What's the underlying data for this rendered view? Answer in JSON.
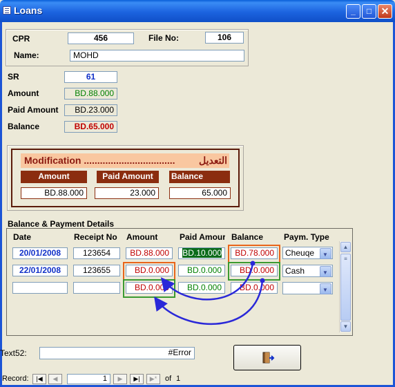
{
  "window": {
    "title": "Loans"
  },
  "header": {
    "cpr_label": "CPR",
    "cpr_value": "456",
    "file_label": "File No:",
    "file_value": "106",
    "name_label": "Name:",
    "name_value": "MOHD"
  },
  "summary": {
    "sr_label": "SR",
    "sr_value": "61",
    "amount_label": "Amount",
    "amount_value": "BD.88.000",
    "paid_label": "Paid Amount",
    "paid_value": "BD.23.000",
    "balance_label": "Balance",
    "balance_value": "BD.65.000"
  },
  "modification": {
    "title": "Modification ..................................",
    "title_ar": "التعديل",
    "headers": [
      "Amount",
      "Paid Amount",
      "Balance"
    ],
    "values": [
      "BD.88.000",
      "23.000",
      "65.000"
    ]
  },
  "details": {
    "section_title": "Balance & Payment Details",
    "columns": [
      "Date",
      "Receipt No",
      "Amount",
      "Paid Amour",
      "Balance",
      "Paym. Type"
    ],
    "rows": [
      {
        "date": "20/01/2008",
        "receipt": "123654",
        "amount": "BD.88.000",
        "paid": "BD.10.000",
        "balance": "BD.78.000",
        "type": "Cheuqe"
      },
      {
        "date": "22/01/2008",
        "receipt": "123655",
        "amount": "BD.0.000",
        "paid": "BD.0.000",
        "balance": "BD.0.000",
        "type": "Cash"
      },
      {
        "date": "",
        "receipt": "",
        "amount": "BD.0.000",
        "paid": "BD.0.000",
        "balance": "BD.0.000",
        "type": ""
      }
    ]
  },
  "footer": {
    "text_label": "Text52:",
    "text_value": "#Error"
  },
  "navigation": {
    "record_label": "Record:",
    "record_value": "1",
    "of_label": "of",
    "total": "1"
  },
  "colors": {
    "titlebar": "#1c63df",
    "accent_blue": "#1030c8",
    "balance_red": "#c00000",
    "mod_header": "#8b2d0f",
    "highlight_orange": "#e8651a",
    "highlight_green": "#3a9a30",
    "arrow": "#2a28d8"
  },
  "icons": {
    "app": "form-icon",
    "exit": "exit-door-icon"
  }
}
